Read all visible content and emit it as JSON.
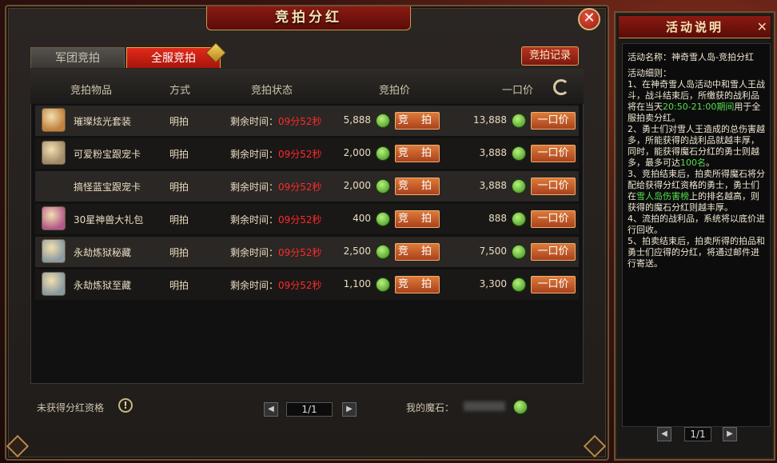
{
  "window": {
    "title": "竞拍分红",
    "close_symbol": "✕"
  },
  "tabs": [
    {
      "label": "军团竞拍",
      "active": false
    },
    {
      "label": "全服竞拍",
      "active": true
    }
  ],
  "record_button": "竞拍记录",
  "columns": [
    "竞拍物品",
    "方式",
    "竞拍状态",
    "竞拍价",
    "一口价"
  ],
  "refresh_icon": "refresh-icon",
  "status_prefix": "剩余时间：",
  "bid_label": "竞 拍",
  "buy_label": "一口价",
  "rows": [
    {
      "name": "璀璨炫光套装",
      "method": "明拍",
      "time": "09分52秒",
      "bid": "5,888",
      "buyout": "13,888",
      "icon_color": "#c0803a"
    },
    {
      "name": "可爱粉宝跟宠卡",
      "method": "明拍",
      "time": "09分52秒",
      "bid": "2,000",
      "buyout": "3,888",
      "icon_color": "#a08a6a"
    },
    {
      "name": "搞怪蓝宝跟宠卡",
      "method": "明拍",
      "time": "09分52秒",
      "bid": "2,000",
      "buyout": "3,888",
      "icon_color": ""
    },
    {
      "name": "30星神兽大礼包",
      "method": "明拍",
      "time": "09分52秒",
      "bid": "400",
      "buyout": "888",
      "icon_color": "#b45a8a"
    },
    {
      "name": "永劫炼狱秘藏",
      "method": "明拍",
      "time": "09分52秒",
      "bid": "2,500",
      "buyout": "7,500",
      "icon_color": "#8a9aa0"
    },
    {
      "name": "永劫炼狱至藏",
      "method": "明拍",
      "time": "09分52秒",
      "bid": "1,100",
      "buyout": "3,300",
      "icon_color": "#8a9aa0"
    }
  ],
  "footer": {
    "qualification": "未获得分红资格",
    "info_symbol": "!",
    "page": "1/1",
    "prev_symbol": "◀",
    "next_symbol": "▶",
    "my_gems_label": "我的魔石："
  },
  "side": {
    "title": "活动说明",
    "close_symbol": "✕",
    "name_line": "活动名称：神奇雪人岛-竞拍分红",
    "rules_title": "活动细则：",
    "rule1_a": "1、在神奇雪人岛活动中和雪人王战斗，战斗结束后，所缴获的战利品将在当天",
    "rule1_time": "20:50-21:00期间",
    "rule1_b": "用于全服拍卖分红。",
    "rule2_a": "2、勇士们对雪人王造成的总伤害越多，所能获得的战利品就越丰厚，同时，能获得魔石分红的勇士则越多，最多可达",
    "rule2_count": "100名",
    "rule2_b": "。",
    "rule3_a": "3、竞拍结束后，拍卖所得魔石将分配给获得分红资格的勇士，勇士们在",
    "rule3_rank": "雪人岛伤害榜",
    "rule3_b": "上的排名越高，则获得的魔石分红则越丰厚。",
    "rule4": "4、流拍的战利品，系统将以底价进行回收。",
    "rule5": "5、拍卖结束后，拍卖所得的拍品和勇士们应得的分红，将通过邮件进行寄送。",
    "page": "1/1",
    "prev_symbol": "◀",
    "next_symbol": "▶"
  },
  "colors": {
    "accent_red": "#e02a1a",
    "timer_red": "#ff2a2a",
    "highlight_green": "#54e04c",
    "button_orange": "#dd7a3a"
  }
}
